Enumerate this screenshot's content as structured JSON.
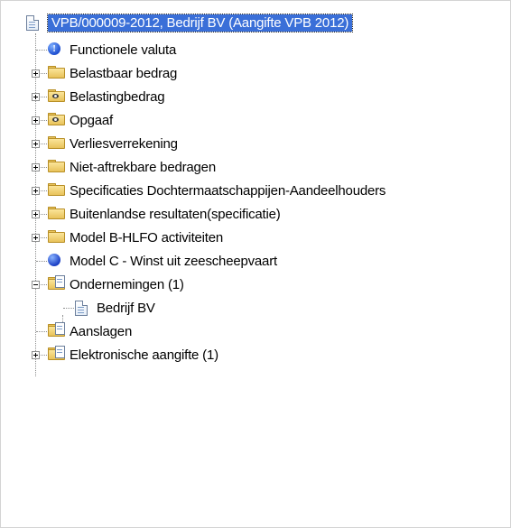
{
  "tree": {
    "root": {
      "label": "VPB/000009-2012, Bedrijf BV (Aangifte VPB 2012)",
      "icon": "document-icon"
    },
    "items": [
      {
        "label": "Functionele valuta",
        "icon": "info-icon",
        "expander": "none"
      },
      {
        "label": "Belastbaar bedrag",
        "icon": "folder-icon",
        "expander": "plus"
      },
      {
        "label": "Belastingbedrag",
        "icon": "folder-eye-icon",
        "expander": "plus"
      },
      {
        "label": "Opgaaf",
        "icon": "folder-eye-icon",
        "expander": "plus"
      },
      {
        "label": "Verliesverrekening",
        "icon": "folder-icon",
        "expander": "plus"
      },
      {
        "label": "Niet-aftrekbare bedragen",
        "icon": "folder-icon",
        "expander": "plus"
      },
      {
        "label": "Specificaties Dochtermaatschappijen-Aandeelhouders",
        "icon": "folder-icon",
        "expander": "plus"
      },
      {
        "label": "Buitenlandse resultaten(specificatie)",
        "icon": "folder-icon",
        "expander": "plus"
      },
      {
        "label": "Model B-HLFO activiteiten",
        "icon": "folder-icon",
        "expander": "plus"
      },
      {
        "label": "Model C - Winst uit zeescheepvaart",
        "icon": "blue-dot-icon",
        "expander": "none"
      },
      {
        "label": "Ondernemingen (1)",
        "icon": "folder-document-icon",
        "expander": "minus"
      },
      {
        "label": "Bedrijf BV",
        "icon": "document-icon",
        "expander": "none"
      },
      {
        "label": "Aanslagen",
        "icon": "folder-document-icon",
        "expander": "none"
      },
      {
        "label": "Elektronische aangifte (1)",
        "icon": "folder-document-icon",
        "expander": "plus"
      }
    ]
  }
}
